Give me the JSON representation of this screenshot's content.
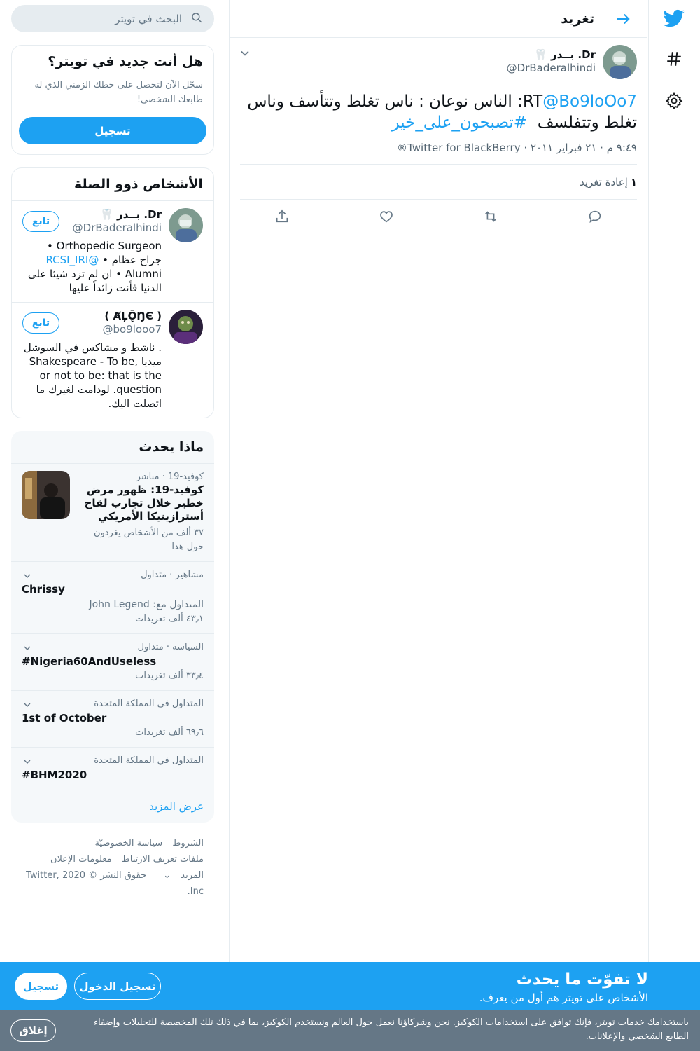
{
  "colors": {
    "accent": "#1da1f2",
    "muted": "#657786",
    "border": "#e6ecf0",
    "cookie_bg": "#657786"
  },
  "rail": {
    "icons": [
      "twitter-logo-icon",
      "hashtag-icon",
      "settings-gear-icon"
    ]
  },
  "header": {
    "title": "تغريد",
    "back_icon": "arrow-back-icon"
  },
  "tweet": {
    "author_name": "Dr. بــدر 🦷",
    "author_handle": "@DrBaderalhindi",
    "text_rt": "RT",
    "text_mention": "@Bo9loOo7",
    "text_body": ": الناس نوعان : ناس تغلط وتتأسف وناس تغلط وتتفلسف",
    "text_hashtag": "#تصبحون_على_خير",
    "meta": "٩:٤٩ م · ٢١ فبراير ٢٠١١ · Twitter for BlackBerry®",
    "retweet_count": "١",
    "retweet_label": "إعادة تغريد",
    "actions": [
      "reply-icon",
      "retweet-icon",
      "like-icon",
      "share-icon"
    ]
  },
  "sidebar": {
    "search_placeholder": "البحث في تويتر",
    "newto": {
      "title": "هل أنت جديد في تويتر؟",
      "text": "سجّل الآن لتحصل على خطك الزمني الذي له طابعك الشخصي!",
      "button": "تسجيل"
    },
    "people": {
      "title": "الأشخاص ذوو الصلة",
      "items": [
        {
          "name": "Dr. بــدر 🦷",
          "handle": "@DrBaderalhindi",
          "bio_1": "Orthopedic Surgeon • جراح عظام • ",
          "bio_link": "@RCSI_IRI",
          "bio_2": " Alumni • ان لم تزد شيئا على الدنيا فأنت زائداً عليها",
          "follow": "تابع"
        },
        {
          "name": "( ȺĻǬŊЄ )",
          "handle": "@bo9looo7",
          "bio": ". ناشط و مشاكس في السوشل ميديا Shakespeare - To be, or not to be: that is the question. لودامت لغيرك ما اتصلت اليك.",
          "follow": "تابع"
        }
      ]
    },
    "trends": {
      "title": "ماذا يحدث",
      "news": {
        "meta": "كوفيد-19 · مباشر",
        "title": "كوفيد-19: ظهور مرض خطير خلال تجارب لقاح أسترازينيكا الأمريكي",
        "count": "٣٧ ألف من الأشخاص يغردون حول هذا"
      },
      "items": [
        {
          "meta": "مشاهير · متداول",
          "name": "Chrissy",
          "sub": "المتداول مع: John Legend",
          "count": "٤٣٫١ ألف تغريدات"
        },
        {
          "meta": "السياسه · متداول",
          "name": "#Nigeria60AndUseless",
          "count": "٣٣٫٤ ألف تغريدات"
        },
        {
          "meta": "المتداول في المملكة المتحدة",
          "name": "1st of October",
          "count": "٦٩٫٦ ألف تغريدات"
        },
        {
          "meta": "المتداول في المملكة المتحدة",
          "name": "#BHM2020"
        }
      ],
      "show_more": "عرض المزيد"
    },
    "footer": {
      "terms": "الشروط",
      "privacy": "سياسة الخصوصيّة",
      "cookies": "ملفات تعريف الارتباط",
      "ads": "معلومات الإعلان",
      "more": "المزيد",
      "copyright": "حقوق النشر © 2020 Twitter, Inc."
    }
  },
  "signup_bar": {
    "title": "لا تفوّت ما يحدث",
    "subtitle": "الأشخاص على تويتر هم أول من يعرف.",
    "login": "تسجيل الدخول",
    "signup": "تسجيل"
  },
  "cookie_bar": {
    "text_1": "باستخدامك خدمات تويتر، فإنك توافق على ",
    "link": "استخدامات الكوكيز",
    "text_2": ". نحن وشركاؤنا نعمل حول العالم ونستخدم الكوكيز، بما في ذلك تلك المخصصة للتحليلات وإضفاء الطابع الشخصي والإعلانات.",
    "close": "إغلاق"
  }
}
